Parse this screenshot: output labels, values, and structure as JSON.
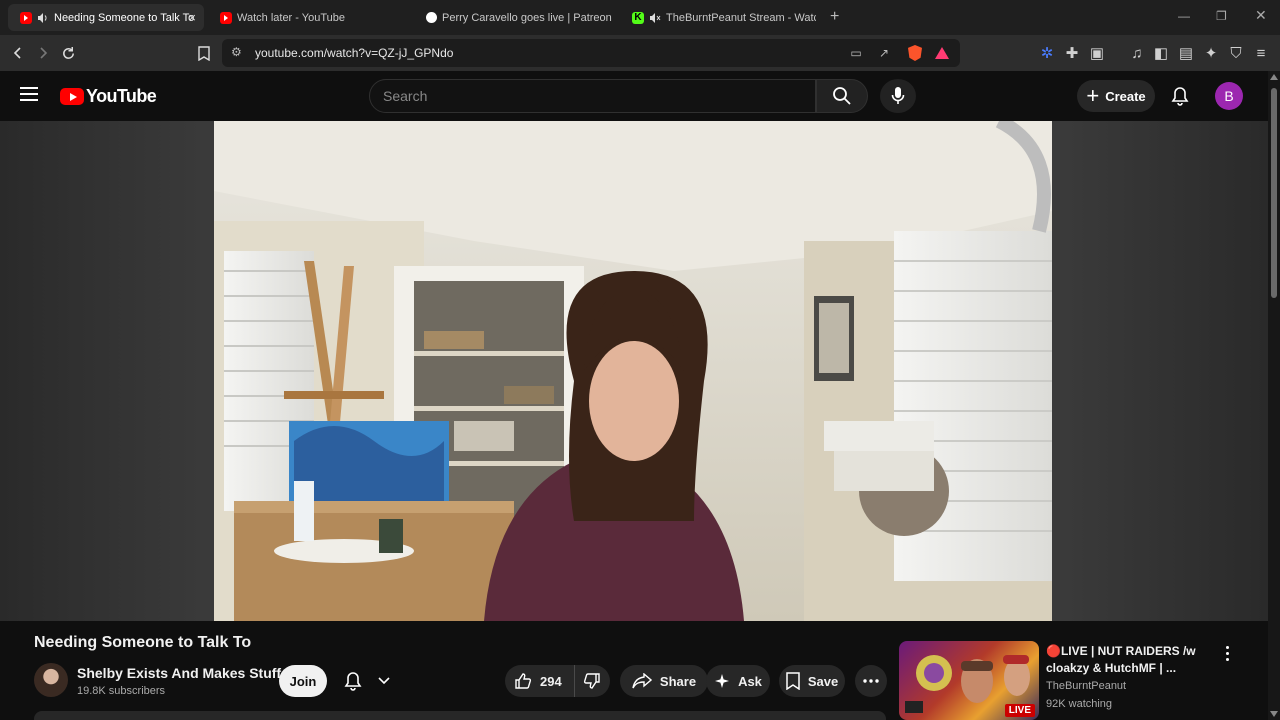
{
  "browser": {
    "tabs": [
      {
        "label": "Needing Someone to Talk To",
        "favicon": "youtube-icon",
        "audio": true,
        "active": true
      },
      {
        "label": "Watch later - YouTube",
        "favicon": "youtube-icon",
        "active": false
      },
      {
        "label": "Perry Caravello goes live | Patreon",
        "favicon": "patreon-icon",
        "active": false
      },
      {
        "label": "TheBurntPeanut Stream - Watch",
        "favicon": "kick-icon",
        "audio": true,
        "muted": true,
        "active": false
      }
    ],
    "new_tab_symbol": "+",
    "close_symbol": "×",
    "url": "youtube.com/watch?v=QZ-jJ_GPNdo"
  },
  "youtube": {
    "logo_text": "YouTube",
    "search_placeholder": "Search",
    "create_label": "Create",
    "avatar_letter": "B",
    "accent_color": "#ff0000",
    "avatar_color": "#9c27b0"
  },
  "video": {
    "title": "Needing Someone to Talk To",
    "channel": {
      "name": "Shelby Exists And Makes Stuff",
      "subscribers": "19.8K subscribers"
    },
    "join_label": "Join",
    "actions": {
      "likes": "294",
      "share_label": "Share",
      "ask_label": "Ask",
      "save_label": "Save"
    }
  },
  "recommendation": {
    "title": "🔴LIVE | NUT RAIDERS /w cloakzy & HutchMF | ...",
    "channel": "TheBurntPeanut",
    "viewers": "92K watching",
    "badge": "LIVE"
  }
}
